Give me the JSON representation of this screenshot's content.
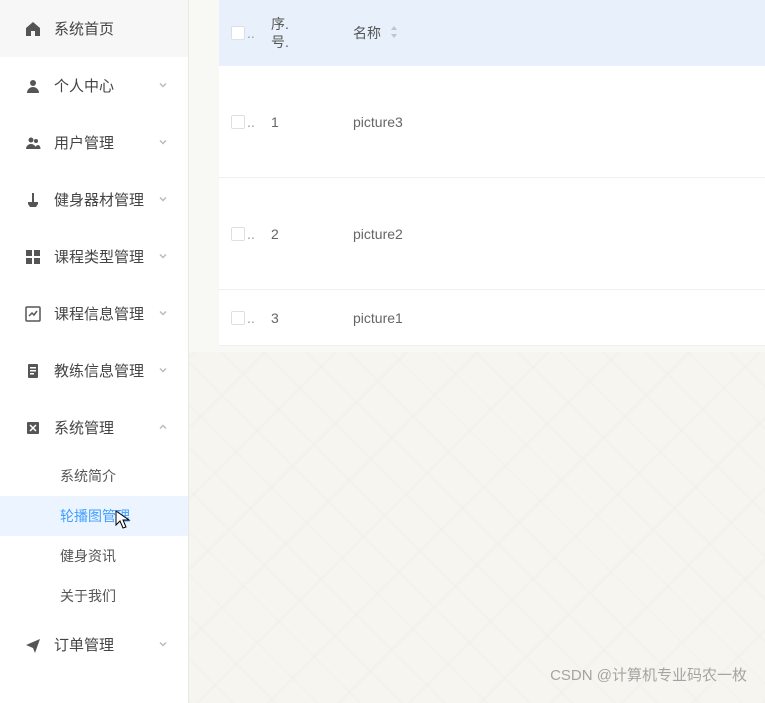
{
  "sidebar": {
    "items": [
      {
        "label": "系统首页",
        "icon": "home",
        "expandable": false
      },
      {
        "label": "个人中心",
        "icon": "person",
        "expandable": true,
        "expanded": false
      },
      {
        "label": "用户管理",
        "icon": "users",
        "expandable": true,
        "expanded": false
      },
      {
        "label": "健身器材管理",
        "icon": "equipment",
        "expandable": true,
        "expanded": false
      },
      {
        "label": "课程类型管理",
        "icon": "grid",
        "expandable": true,
        "expanded": false
      },
      {
        "label": "课程信息管理",
        "icon": "chart",
        "expandable": true,
        "expanded": false
      },
      {
        "label": "教练信息管理",
        "icon": "doc",
        "expandable": true,
        "expanded": false
      },
      {
        "label": "系统管理",
        "icon": "system",
        "expandable": true,
        "expanded": true,
        "submenu": [
          {
            "label": "系统简介",
            "active": false
          },
          {
            "label": "轮播图管理",
            "active": true
          },
          {
            "label": "健身资讯",
            "active": false
          },
          {
            "label": "关于我们",
            "active": false
          }
        ]
      },
      {
        "label": "订单管理",
        "icon": "plane",
        "expandable": true,
        "expanded": false
      }
    ]
  },
  "table": {
    "headers": {
      "seq": "序.\n号.",
      "name": "名称"
    },
    "rows": [
      {
        "seq": "1",
        "name": "picture3"
      },
      {
        "seq": "2",
        "name": "picture2"
      },
      {
        "seq": "3",
        "name": "picture1"
      }
    ]
  },
  "watermark": "CSDN @计算机专业码农一枚"
}
